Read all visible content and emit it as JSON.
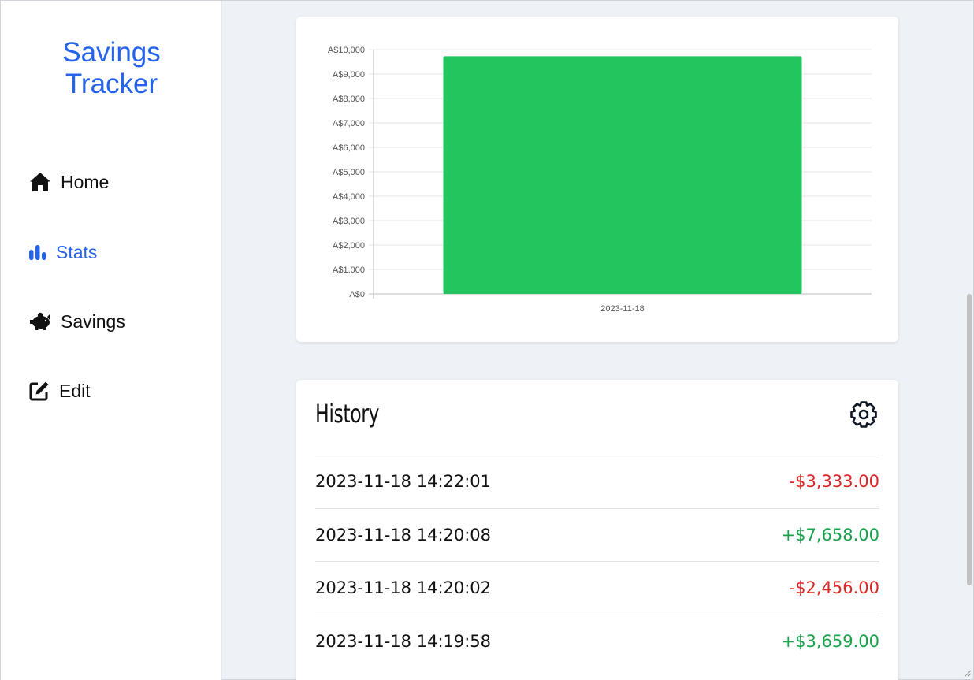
{
  "brand": {
    "line1": "Savings",
    "line2": "Tracker",
    "color": "#2563eb"
  },
  "nav": [
    {
      "label": "Home",
      "icon": "home-icon",
      "active": false
    },
    {
      "label": "Stats",
      "icon": "bar-chart-icon",
      "active": true
    },
    {
      "label": "Savings",
      "icon": "piggy-bank-icon",
      "active": false
    },
    {
      "label": "Edit",
      "icon": "edit-icon",
      "active": false
    }
  ],
  "chart_data": {
    "type": "bar",
    "categories": [
      "2023-11-18"
    ],
    "values": [
      9728
    ],
    "ylim": [
      0,
      10000
    ],
    "yticks": [
      "A$0",
      "A$1,000",
      "A$2,000",
      "A$3,000",
      "A$4,000",
      "A$5,000",
      "A$6,000",
      "A$7,000",
      "A$8,000",
      "A$9,000",
      "A$10,000"
    ],
    "grid": true,
    "bar_color": "#22c55e"
  },
  "history": {
    "title": "History",
    "settings_icon": "gear-icon",
    "rows": [
      {
        "timestamp": "2023-11-18 14:22:01",
        "amount": "-$3,333.00",
        "sign": "neg"
      },
      {
        "timestamp": "2023-11-18 14:20:08",
        "amount": "+$7,658.00",
        "sign": "pos"
      },
      {
        "timestamp": "2023-11-18 14:20:02",
        "amount": "-$2,456.00",
        "sign": "neg"
      },
      {
        "timestamp": "2023-11-18 14:19:58",
        "amount": "+$3,659.00",
        "sign": "pos"
      }
    ]
  },
  "colors": {
    "negative": "#dc2626",
    "positive": "#16a34a",
    "active_nav": "#2563eb"
  }
}
